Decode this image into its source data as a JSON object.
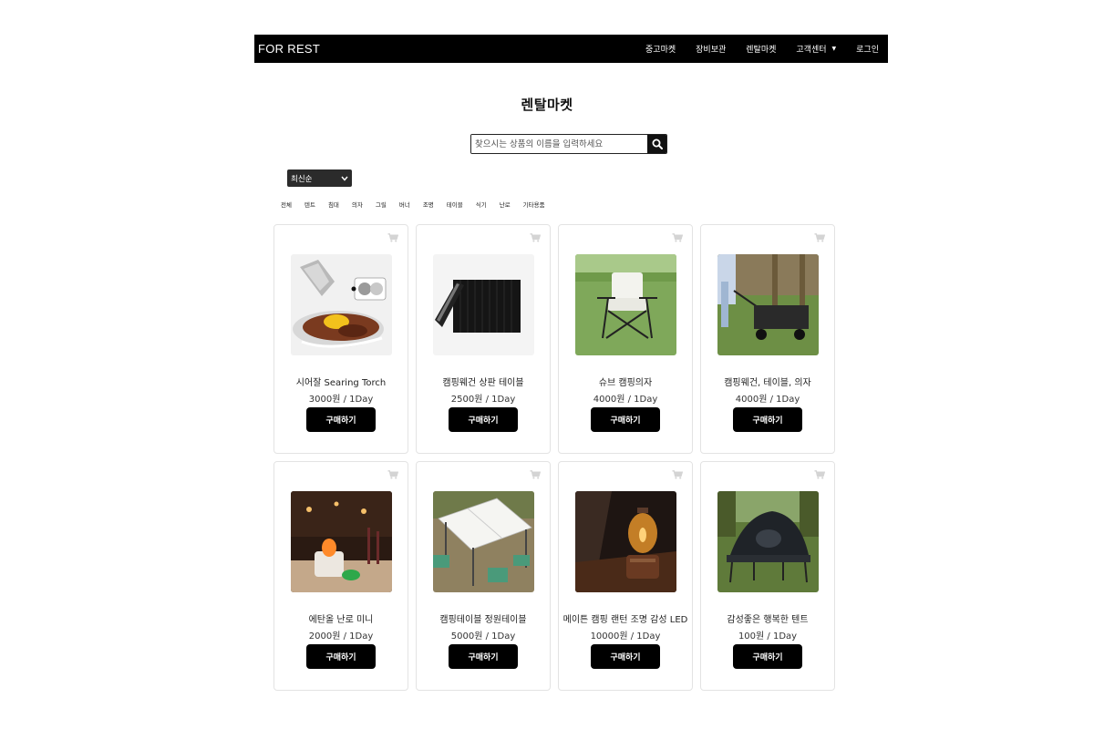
{
  "header": {
    "brand": "FOR REST",
    "menu": [
      {
        "label": "중고마켓"
      },
      {
        "label": "장비보관"
      },
      {
        "label": "렌탈마켓"
      },
      {
        "label": "고객센터"
      },
      {
        "label": "로그인"
      }
    ]
  },
  "page": {
    "title": "렌탈마켓"
  },
  "search": {
    "placeholder": "찾으시는 상품의 이름을 입력하세요"
  },
  "sort": {
    "selected": "최신순"
  },
  "categories": [
    "전체",
    "텐트",
    "침대",
    "의자",
    "그릴",
    "버너",
    "조명",
    "테이블",
    "식기",
    "난로",
    "기타용품"
  ],
  "products": [
    {
      "name": "시어잘 Searing Torch",
      "price": "3000원 / 1Day",
      "button": "구매하기",
      "image": "searing-torch-photo"
    },
    {
      "name": "캠핑웨건 상판 테이블",
      "price": "2500원 / 1Day",
      "button": "구매하기",
      "image": "wagon-table-photo"
    },
    {
      "name": "슈브 캠핑의자",
      "price": "4000원 / 1Day",
      "button": "구매하기",
      "image": "camping-chair-photo"
    },
    {
      "name": "캠핑웨건, 테이블, 의자",
      "price": "4000원 / 1Day",
      "button": "구매하기",
      "image": "camping-wagon-photo"
    },
    {
      "name": "에탄올 난로 미니",
      "price": "2000원 / 1Day",
      "button": "구매하기",
      "image": "ethanol-heater-photo"
    },
    {
      "name": "캠핑테이블 정원테이블",
      "price": "5000원 / 1Day",
      "button": "구매하기",
      "image": "garden-table-photo"
    },
    {
      "name": "메이튼 캠핑 랜턴 조명 감성 LED",
      "price": "10000원 / 1Day",
      "button": "구매하기",
      "image": "lantern-photo"
    },
    {
      "name": "감성좋은 행복한 텐트",
      "price": "100원 / 1Day",
      "button": "구매하기",
      "image": "cot-tent-photo"
    }
  ]
}
